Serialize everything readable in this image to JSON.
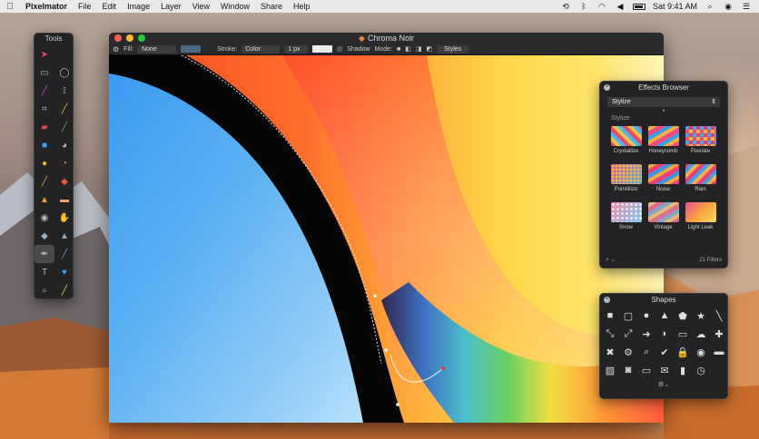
{
  "menubar": {
    "apple": "",
    "items": [
      "Pixelmator",
      "File",
      "Edit",
      "Image",
      "Layer",
      "View",
      "Window",
      "Share",
      "Help"
    ],
    "clock": "Sat 9:41 AM"
  },
  "tools": {
    "title": "Tools",
    "icons": [
      "arrow",
      "rect-select",
      "lasso",
      "magic-wand",
      "crop",
      "color-picker",
      "type",
      "gradient",
      "paint-bucket",
      "sponge",
      "dodge",
      "burn",
      "eraser",
      "clone",
      "brush",
      "pencil",
      "eye",
      "blur",
      "smudge",
      "sharpen",
      "pen",
      "shape",
      "text",
      "heart",
      "zoom",
      "hand"
    ]
  },
  "document": {
    "title": "Chroma Noir",
    "toolbar": {
      "fill_label": "Fill:",
      "fill_value": "None",
      "stroke_label": "Stroke:",
      "stroke_value": "Color",
      "stroke_size": "1 px",
      "shadow_label": "Shadow",
      "mode_label": "Mode:",
      "styles_label": "Styles"
    },
    "colors": {
      "fill_swatch": "#4a6a86",
      "stroke_swatch": "#ffffff"
    }
  },
  "effects": {
    "title": "Effects Browser",
    "category": "Stylize",
    "section": "Stylize",
    "items": [
      {
        "label": "Crystallize"
      },
      {
        "label": "Honeycomb"
      },
      {
        "label": "Pixelate"
      },
      {
        "label": "Pointillize"
      },
      {
        "label": "Noise"
      },
      {
        "label": "Rain"
      },
      {
        "label": "Snow"
      },
      {
        "label": "Vintage"
      },
      {
        "label": "Light Leak"
      }
    ],
    "filter_count": "21 Filters"
  },
  "shapes": {
    "title": "Shapes",
    "glyphs": [
      "■",
      "▢",
      "●",
      "▲",
      "⬟",
      "★",
      "╲",
      "⤢",
      "⟷",
      "➜",
      "💬",
      "▭",
      "☁",
      "✚",
      "✖",
      "⚙",
      "🔍",
      "✔",
      "🔒",
      "👁",
      "▬",
      "▨",
      "📷",
      "▭",
      "✉",
      "▮",
      "◐"
    ]
  }
}
